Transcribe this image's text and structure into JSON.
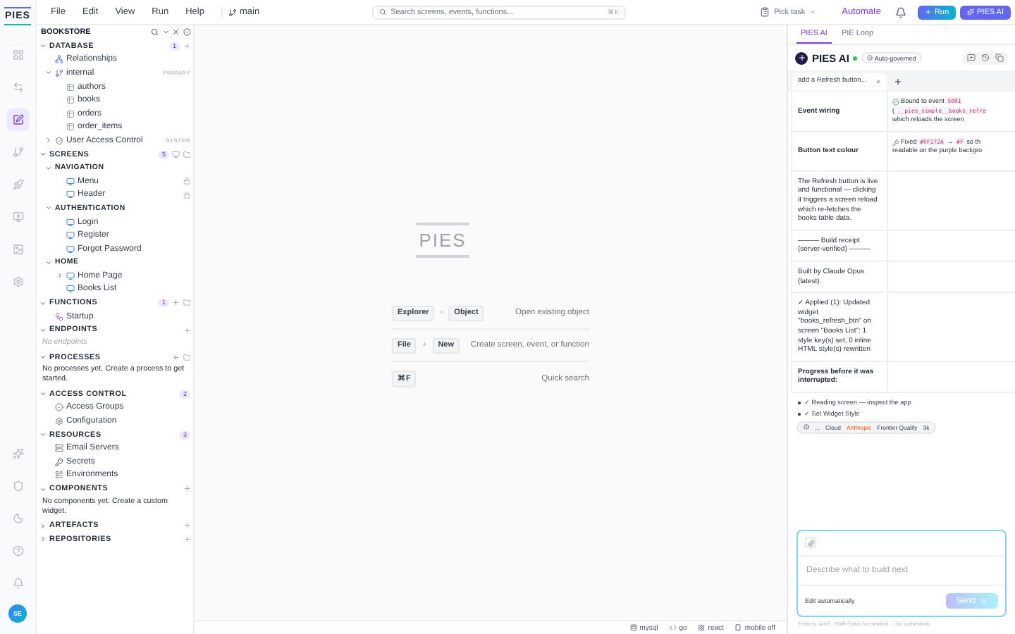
{
  "menu": [
    "File",
    "Edit",
    "View",
    "Run",
    "Help"
  ],
  "branch": "main",
  "search": {
    "placeholder": "Search screens, events, functions...",
    "shortcut": "⌘K"
  },
  "pick_task": "Pick task",
  "automate": "Automate",
  "run_button": "Run",
  "ai_button": "PIES AI",
  "rail": {
    "logo": "PIES",
    "items": [
      {
        "selected": false
      },
      {
        "selected": false
      },
      {
        "selected": true
      },
      {
        "selected": false
      },
      {
        "selected": false
      },
      {
        "selected": false
      },
      {
        "selected": false
      },
      {
        "selected": false
      }
    ],
    "avatar": "SE"
  },
  "explorer": {
    "title": "BOOKSTORE",
    "sections": [
      {
        "title": "DATABASE",
        "expanded": true,
        "count": "1",
        "actions": [
          {
            "kind": "add"
          }
        ],
        "items": [
          {
            "kind": "relations",
            "label": "Relationships"
          },
          {
            "kind": "schema",
            "label": "internal",
            "tag": "PRIMARY",
            "expanded": true,
            "children": [
              {
                "kind": "table",
                "label": "authors"
              },
              {
                "kind": "table",
                "label": "books"
              },
              {
                "kind": "table",
                "label": "orders"
              },
              {
                "kind": "table",
                "label": "order_items"
              }
            ]
          },
          {
            "kind": "system",
            "label": "User Access Control",
            "tag": "SYSTEM",
            "expanded": false
          }
        ]
      },
      {
        "title": "SCREENS",
        "expanded": true,
        "count": "5",
        "actions": [
          {
            "kind": "screen"
          },
          {
            "kind": "folder"
          }
        ],
        "items": [
          {
            "kind": "group",
            "label": "NAVIGATION",
            "expanded": true,
            "children": [
              {
                "kind": "screen",
                "label": "Menu",
                "locked": true
              },
              {
                "kind": "screen",
                "label": "Header",
                "locked": true
              }
            ]
          },
          {
            "kind": "group",
            "label": "AUTHENTICATION",
            "expanded": true,
            "children": [
              {
                "kind": "screen",
                "label": "Login"
              },
              {
                "kind": "screen",
                "label": "Register"
              },
              {
                "kind": "screen",
                "label": "Forgot Password"
              }
            ]
          },
          {
            "kind": "group",
            "label": "HOME",
            "expanded": true,
            "children": [
              {
                "kind": "screen",
                "label": "Home Page",
                "expanded": false
              },
              {
                "kind": "screen",
                "label": "Books List"
              }
            ]
          }
        ]
      },
      {
        "title": "FUNCTIONS",
        "expanded": true,
        "count": "1",
        "actions": [
          {
            "kind": "add"
          },
          {
            "kind": "folder"
          }
        ],
        "items": [
          {
            "kind": "function",
            "label": "Startup"
          }
        ]
      },
      {
        "title": "ENDPOINTS",
        "expanded": true,
        "actions": [
          {
            "kind": "add"
          }
        ],
        "empty": {
          "text": "No endpoints",
          "muted": true
        }
      },
      {
        "title": "PROCESSES",
        "expanded": true,
        "actions": [
          {
            "kind": "add"
          },
          {
            "kind": "folder"
          }
        ],
        "empty": {
          "text": "No processes yet. Create a process to get started.",
          "muted": false
        }
      },
      {
        "title": "ACCESS CONTROL",
        "expanded": true,
        "count": "2",
        "items": [
          {
            "kind": "access",
            "label": "Access Groups"
          },
          {
            "kind": "config",
            "label": "Configuration"
          }
        ]
      },
      {
        "title": "RESOURCES",
        "expanded": true,
        "count": "3",
        "items": [
          {
            "kind": "server",
            "label": "Email Servers"
          },
          {
            "kind": "secret",
            "label": "Secrets"
          },
          {
            "kind": "env",
            "label": "Environments"
          }
        ]
      },
      {
        "title": "COMPONENTS",
        "expanded": true,
        "actions": [
          {
            "kind": "add"
          }
        ],
        "empty": {
          "text": "No components yet. Create a custom widget.",
          "muted": false
        }
      },
      {
        "title": "ARTEFACTS",
        "expanded": false,
        "actions": [
          {
            "kind": "add"
          }
        ]
      },
      {
        "title": "REPOSITORIES",
        "expanded": false,
        "actions": [
          {
            "kind": "add"
          }
        ]
      }
    ]
  },
  "welcome": {
    "logo": "PIES",
    "shortcuts": [
      {
        "keys": [
          "Explorer",
          "Object"
        ],
        "joiner": "›",
        "description": "Open existing object"
      },
      {
        "keys": [
          "File",
          "New"
        ],
        "joiner": "+",
        "description": "Create screen, event, or function"
      },
      {
        "keys": [
          "⌘F"
        ],
        "description": "Quick search"
      }
    ]
  },
  "status_bar": [
    {
      "kind": "db",
      "label": "mysql"
    },
    {
      "kind": "go",
      "label": "go"
    },
    {
      "kind": "react",
      "label": "react"
    },
    {
      "kind": "mobile",
      "label": "mobile off"
    }
  ],
  "ai_panel": {
    "tabs": [
      {
        "label": "PIES AI",
        "selected": true
      },
      {
        "label": "PIE Loop",
        "selected": false
      }
    ],
    "title": "PIES AI",
    "online": true,
    "badge": "Auto-governed",
    "chats": [
      {
        "label": "add a Refresh button...",
        "selected": true
      }
    ],
    "table": [
      {
        "label": "Event wiring",
        "bold": true,
        "value": {
          "kind": "check",
          "lines": [
            [
              {
                "text": "Bound to event ",
                "code": false
              },
              {
                "text": "5001",
                "code": true
              }
            ],
            [
              {
                "text": "( ",
                "code": false
              },
              {
                "text": "__pies_simple__books_refre",
                "code": true
              }
            ],
            [
              {
                "text": "which reloads the screen",
                "code": false
              }
            ]
          ]
        }
      },
      {
        "label": "Button text colour",
        "bold": true,
        "value": {
          "kind": "fix",
          "lines": [
            [
              {
                "text": "Fixed ",
                "code": false
              },
              {
                "text": "#0F172A",
                "code": true
              },
              {
                "text": " → ",
                "code": false
              },
              {
                "text": "#F",
                "code": true
              },
              {
                "text": " so th",
                "code": false
              }
            ],
            [
              {
                "text": "readable on the purple backgro",
                "code": false
              }
            ]
          ]
        }
      },
      {
        "label": "The Refresh button is live and functional — clicking it triggers a screen reload which re-fetches the books table data.",
        "bold": false
      },
      {
        "label": "——— Build receipt (server-verified) ———",
        "bold": false
      },
      {
        "label": "Built by Claude Opus (latest).",
        "bold": false
      },
      {
        "label": "✓ Applied (1): Updated widget \"books_refresh_btn\" on screen \"Books List\": 1 style key(s) set, 0 inline HTML style(s) rewritten",
        "bold": false
      },
      {
        "label": "Progress before it was interrupted:",
        "bold": true
      }
    ],
    "bullets": [
      "✓ Reading screen — inspect the app",
      "✓ Set Widget Style"
    ],
    "model": [
      {
        "text": "...",
        "highlight": false
      },
      {
        "text": "Cloud",
        "highlight": false
      },
      {
        "text": "Anthropic",
        "highlight": true
      },
      {
        "text": "Frontier Quality",
        "highlight": false
      },
      {
        "text": "3k",
        "highlight": false
      }
    ],
    "composer": {
      "placeholder": "Describe what to build next",
      "mode": "Edit automatically",
      "send": {
        "label": "Send",
        "disabled": true
      }
    },
    "hint": "Enter to send · Shift+Enter for newline · / for commands"
  }
}
